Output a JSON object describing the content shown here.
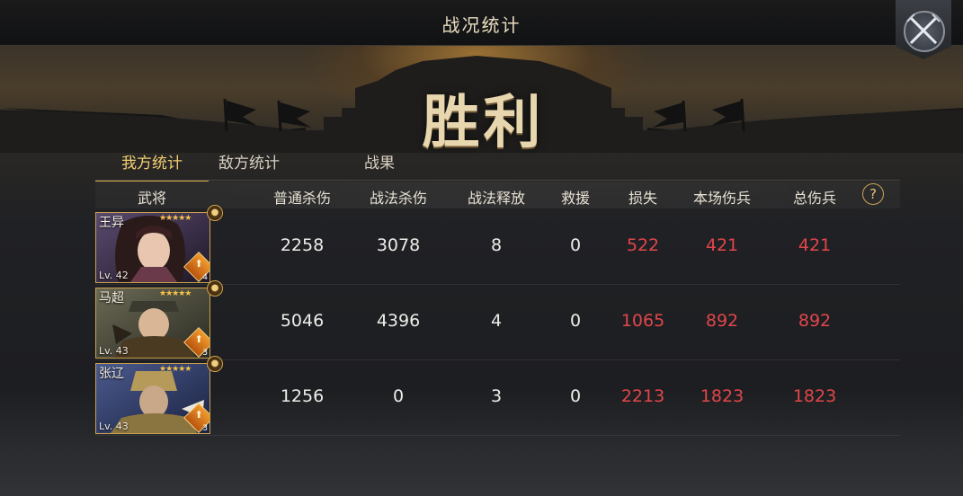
{
  "window": {
    "title": "战况统计"
  },
  "result": {
    "label": "胜利"
  },
  "tabs": [
    {
      "label": "我方统计",
      "active": true
    },
    {
      "label": "敌方统计",
      "active": false
    },
    {
      "label": "战果",
      "active": false
    }
  ],
  "columns": [
    "武将",
    "普通杀伤",
    "战法杀伤",
    "战法释放",
    "救援",
    "损失",
    "本场伤兵",
    "总伤兵"
  ],
  "help_label": "?",
  "rows": [
    {
      "general": {
        "name": "王异",
        "level": "Lv. 42",
        "stars": "★★★★★",
        "skill_count": "4"
      },
      "normal_damage": "2258",
      "tactic_damage": "3078",
      "tactic_casts": "8",
      "rescue": "0",
      "loss": "522",
      "battle_wounded": "421",
      "total_wounded": "421"
    },
    {
      "general": {
        "name": "马超",
        "level": "Lv. 43",
        "stars": "★★★★★",
        "skill_count": "3"
      },
      "normal_damage": "5046",
      "tactic_damage": "4396",
      "tactic_casts": "4",
      "rescue": "0",
      "loss": "1065",
      "battle_wounded": "892",
      "total_wounded": "892"
    },
    {
      "general": {
        "name": "张辽",
        "level": "Lv. 43",
        "stars": "★★★★★",
        "skill_count": "3"
      },
      "normal_damage": "1256",
      "tactic_damage": "0",
      "tactic_casts": "3",
      "rescue": "0",
      "loss": "2213",
      "battle_wounded": "1823",
      "total_wounded": "1823"
    }
  ],
  "colors": {
    "accent_gold": "#f2cf73",
    "loss_red": "#e0464a",
    "card_border": "#c9a04f"
  },
  "icons": {
    "close": "crossed-swords-icon",
    "help": "question-icon",
    "rank": "rank-badge-icon",
    "skill": "skill-badge-icon"
  }
}
